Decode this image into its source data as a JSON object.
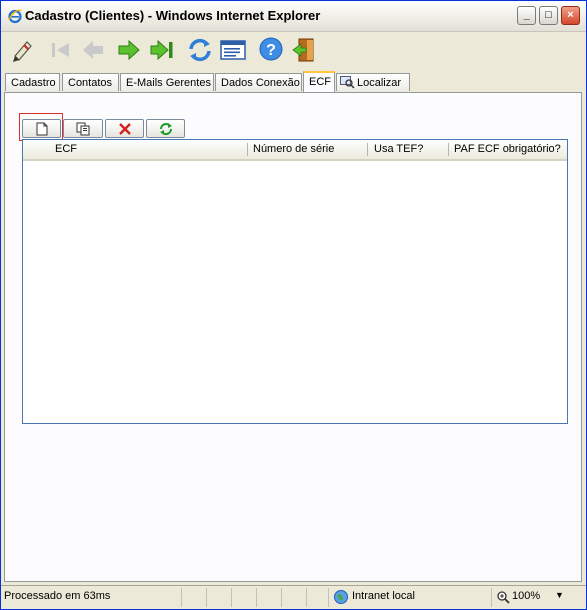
{
  "window": {
    "title": "Cadastro (Clientes) - Windows Internet Explorer",
    "controls": {
      "minimize": "_",
      "maximize": "□",
      "close": "×"
    }
  },
  "toolbar": {
    "icons": [
      "edit-pen-icon",
      "first-record-icon",
      "previous-record-icon",
      "next-record-icon",
      "last-record-icon",
      "refresh-icon",
      "list-view-icon",
      "help-icon",
      "exit-door-icon"
    ]
  },
  "tabs": [
    {
      "label": "Cadastro",
      "active": false
    },
    {
      "label": "Contatos",
      "active": false
    },
    {
      "label": "E-Mails Gerentes",
      "active": false
    },
    {
      "label": "Dados Conexão",
      "active": false
    },
    {
      "label": "ECF",
      "active": true
    },
    {
      "label": "Localizar",
      "active": false,
      "icon": "search-icon"
    }
  ],
  "actions": [
    "new-document-icon",
    "copy-icon",
    "delete-icon",
    "refresh-icon"
  ],
  "grid": {
    "columns": [
      "ECF",
      "Número de série",
      "Usa TEF?",
      "PAF ECF obrigatório?"
    ],
    "rows": []
  },
  "status": {
    "message": "Processado em 63ms",
    "zone": "Intranet local",
    "zoom": "100%"
  },
  "colors": {
    "border_blue": "#0831d9",
    "grid_border": "#4a76b8",
    "active_tab_accent": "#ffc83c"
  }
}
